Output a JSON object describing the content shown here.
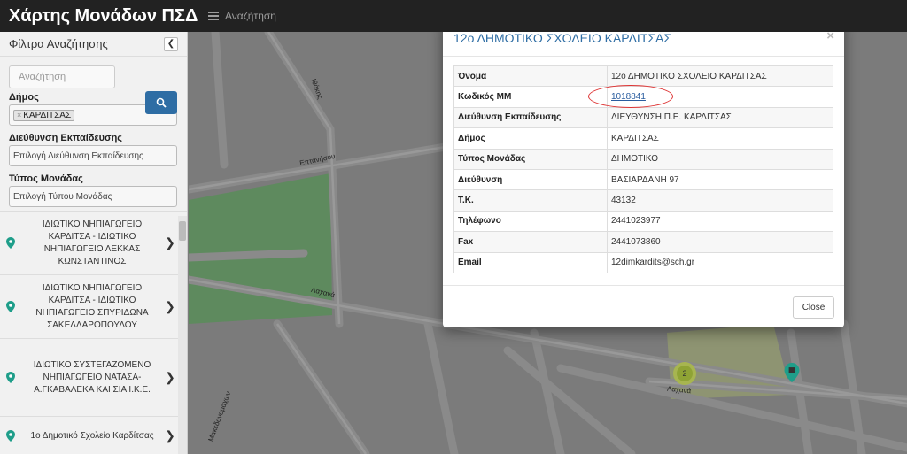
{
  "app": {
    "title": "Χάρτης Μονάδων ΠΣΔ",
    "nav_search": "Αναζήτηση"
  },
  "sidebar": {
    "header": "Φίλτρα Αναζήτησης",
    "search_placeholder": "Αναζήτηση",
    "filters": {
      "municipality_label": "Δήμος",
      "municipality_tag": "ΚΑΡΔΙΤΣΑΣ",
      "directorate_label": "Διεύθυνση Εκπαίδευσης",
      "directorate_placeholder": "Επιλογή Διεύθυνση Εκπαίδευσης",
      "unit_type_label": "Τύπος Μονάδας",
      "unit_type_placeholder": "Επιλογή Τύπου Μονάδας"
    },
    "schools": [
      {
        "name": "ΙΔΙΩΤΙΚΟ ΝΗΠΙΑΓΩΓΕΙΟ ΚΑΡΔΙΤΣΑ - ΙΔΙΩΤΙΚΟ ΝΗΠΙΑΓΩΓΕΙΟ ΛΕΚΚΑΣ ΚΩΝΣΤΑΝΤΙΝΟΣ"
      },
      {
        "name": "ΙΔΙΩΤΙΚΟ ΝΗΠΙΑΓΩΓΕΙΟ ΚΑΡΔΙΤΣΑ - ΙΔΙΩΤΙΚΟ ΝΗΠΙΑΓΩΓΕΙΟ ΣΠΥΡΙΔΩΝΑ ΣΑΚΕΛΛΑΡΟΠΟΥΛΟΥ"
      },
      {
        "name": "ΙΔΙΩΤΙΚΟ ΣΥΣΤΕΓΑΖΟΜΕΝΟ ΝΗΠΙΑΓΩΓΕΙΟ ΝΑΤΑΣΑ-Α.ΓΚΑΒΑΛΕΚΑ ΚΑΙ ΣΙΑ Ι.Κ.Ε."
      },
      {
        "name": "1ο Δημοτικό Σχολείο Καρδίτσας"
      }
    ]
  },
  "map": {
    "streets": {
      "ithakis": "Ιθάκης",
      "eptanisou": "Επτανήσου",
      "lachana_upper": "Λαχανά",
      "lachana_lower": "Λαχανά",
      "makedonomachon": "Μακεδονομάχων"
    },
    "cluster_count": "2"
  },
  "modal": {
    "title": "12ο ΔΗΜΟΤΙΚΟ ΣΧΟΛΕΙΟ ΚΑΡΔΙΤΣΑΣ",
    "close_icon": "×",
    "rows": [
      {
        "key": "Όνομα",
        "value": "12ο ΔΗΜΟΤΙΚΟ ΣΧΟΛΕΙΟ ΚΑΡΔΙΤΣΑΣ"
      },
      {
        "key": "Κωδικός ΜΜ",
        "value": "1018841"
      },
      {
        "key": "Διεύθυνση Εκπαίδευσης",
        "value": "ΔΙΕΥΘΥΝΣΗ Π.Ε. ΚΑΡΔΙΤΣΑΣ"
      },
      {
        "key": "Δήμος",
        "value": "ΚΑΡΔΙΤΣΑΣ"
      },
      {
        "key": "Τύπος Μονάδας",
        "value": "ΔΗΜΟΤΙΚΟ"
      },
      {
        "key": "Διεύθυνση",
        "value": "ΒΑΣΙΑΡΔΑΝΗ 97"
      },
      {
        "key": "Τ.Κ.",
        "value": "43132"
      },
      {
        "key": "Τηλέφωνο",
        "value": "2441023977"
      },
      {
        "key": "Fax",
        "value": "2441073860"
      },
      {
        "key": "Email",
        "value": "12dimkardits@sch.gr"
      }
    ],
    "close_button": "Close"
  },
  "colors": {
    "navbar": "#222222",
    "accent": "#2e6da4",
    "marker": "#1f9e8a",
    "highlight": "#dd3333"
  }
}
